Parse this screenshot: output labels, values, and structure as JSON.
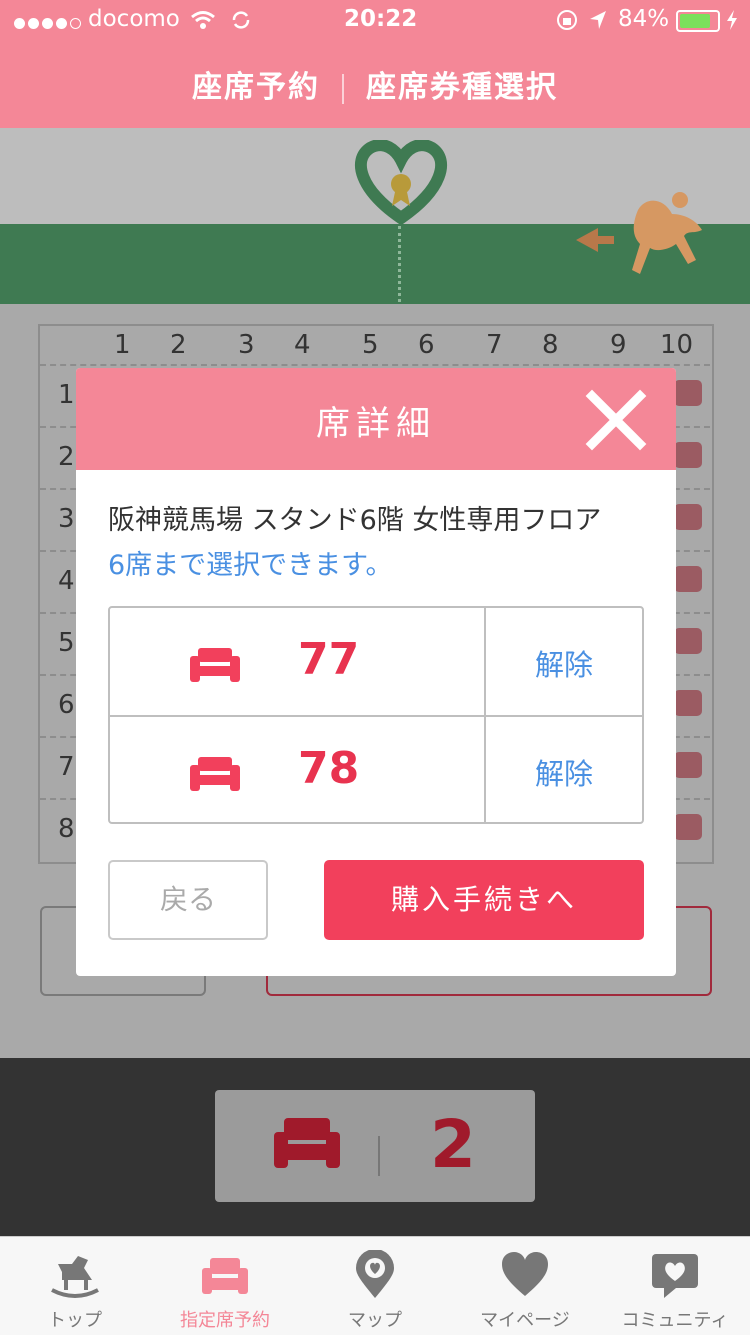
{
  "status_bar": {
    "carrier": "docomo",
    "time": "20:22",
    "battery": "84%",
    "battery_level": 0.84
  },
  "header": {
    "title_left": "座席予約",
    "title_right": "座席券種選択"
  },
  "grid": {
    "columns": [
      "1",
      "2",
      "3",
      "4",
      "5",
      "6",
      "7",
      "8",
      "9",
      "10"
    ],
    "rows": [
      "1",
      "2",
      "3",
      "4",
      "5",
      "6",
      "7",
      "8"
    ]
  },
  "selected_count": "2",
  "modal": {
    "title": "席詳細",
    "venue": "阪神競馬場 スタンド6階 女性専用フロア",
    "limit_note": "6席まで選択できます。",
    "seats": [
      {
        "number": "77",
        "release_label": "解除"
      },
      {
        "number": "78",
        "release_label": "解除"
      }
    ],
    "back_label": "戻る",
    "purchase_label": "購入手続きへ"
  },
  "tabs": [
    {
      "label": "トップ",
      "icon": "rocking-horse-icon"
    },
    {
      "label": "指定席予約",
      "icon": "seat-icon",
      "active": true
    },
    {
      "label": "マップ",
      "icon": "map-pin-icon"
    },
    {
      "label": "マイページ",
      "icon": "heart-icon"
    },
    {
      "label": "コミュニティ",
      "icon": "chat-heart-icon"
    }
  ],
  "colors": {
    "brand_pink": "#f48797",
    "accent_red": "#f2405c",
    "link_blue": "#4a90e2"
  }
}
